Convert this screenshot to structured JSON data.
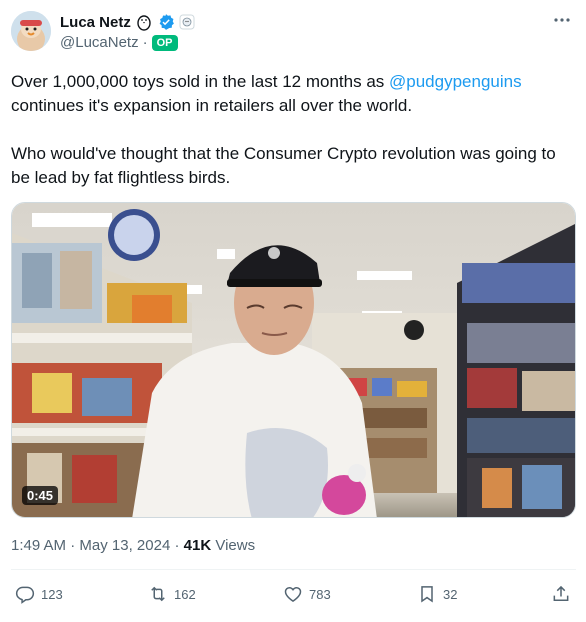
{
  "author": {
    "name": "Luca Netz",
    "handle": "@LucaNetz",
    "separator": "·",
    "op_label": "OP"
  },
  "tweet": {
    "para1_before": "Over 1,000,000 toys sold in the last 12 months as ",
    "mention": "@pudgypenguins",
    "para1_after": " continues it's expansion in retailers all over the world.",
    "para2": "Who would've thought that the Consumer Crypto revolution was going to be lead by fat flightless birds."
  },
  "media": {
    "duration": "0:45"
  },
  "meta": {
    "time": "1:49 AM",
    "sep1": "·",
    "date": "May 13, 2024",
    "sep2": "·",
    "views_count": "41K",
    "views_label": "Views"
  },
  "actions": {
    "replies": "123",
    "reposts": "162",
    "likes": "783",
    "bookmarks": "32"
  },
  "icons": {
    "more": "more-icon",
    "verified": "verified-icon",
    "penguin": "penguin-icon",
    "affiliate": "affiliate-badge-icon",
    "reply": "reply-icon",
    "repost": "repost-icon",
    "like": "heart-icon",
    "bookmark": "bookmark-icon",
    "share": "share-icon"
  },
  "colors": {
    "accent": "#1d9bf0",
    "op_badge": "#00ba7c",
    "secondary_text": "#536471"
  }
}
